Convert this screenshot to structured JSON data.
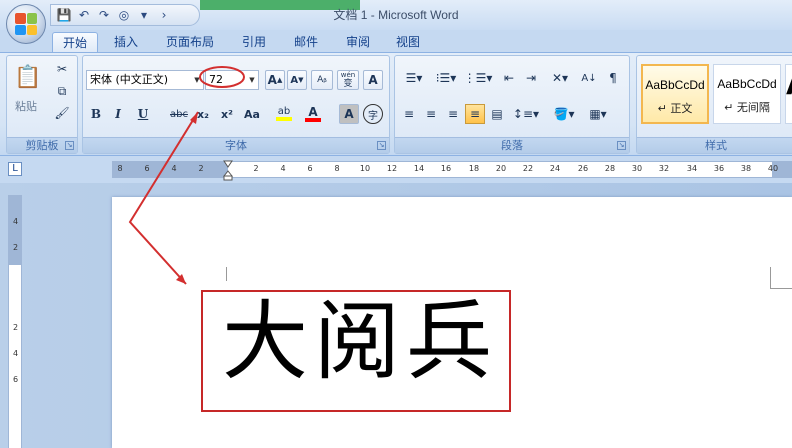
{
  "window": {
    "title": "文档 1 - Microsoft Word"
  },
  "tabs": [
    "开始",
    "插入",
    "页面布局",
    "引用",
    "邮件",
    "审阅",
    "视图"
  ],
  "clipboard": {
    "paste_label": "粘贴",
    "group_label": "剪贴板"
  },
  "font": {
    "name": "宋体 (中文正文)",
    "size": "72",
    "grow_label": "A",
    "shrink_label": "A",
    "wen_label": "wén",
    "bian_label": "变",
    "bold": "B",
    "italic": "I",
    "underline": "U",
    "strike": "abc",
    "subscript": "x₂",
    "superscript": "x²",
    "case": "Aa",
    "highlight": "ab",
    "font_color": "A",
    "shade": "A",
    "enclose": "字",
    "group_label": "字体"
  },
  "paragraph": {
    "group_label": "段落"
  },
  "styles": {
    "items": [
      {
        "sample": "AaBbCcDd",
        "name": "↵ 正文"
      },
      {
        "sample": "AaBbCcDd",
        "name": "↵ 无间隔"
      }
    ],
    "group_label": "样式"
  },
  "ruler": {
    "corner": "L",
    "numbers": [
      "8",
      "6",
      "4",
      "2",
      "2",
      "4",
      "6",
      "8",
      "10",
      "12",
      "14",
      "16",
      "18",
      "20",
      "22",
      "24",
      "26",
      "28",
      "30",
      "32",
      "34",
      "36",
      "38",
      "40"
    ],
    "vnumbers": [
      "4",
      "2",
      "2",
      "4",
      "6"
    ]
  },
  "document": {
    "text": "大阅兵"
  },
  "colors": {
    "annotation_red": "#d32f2f",
    "highlight_yellow": "#ffff00",
    "font_red": "#ff0000",
    "accent_blue": "#15428b"
  },
  "icons": [
    "office-logo-icon",
    "save-icon",
    "undo-icon",
    "redo-icon",
    "clear-icon",
    "customize-icon",
    "cut-icon",
    "copy-icon",
    "format-painter-icon",
    "bullets-icon",
    "numbering-icon",
    "multilevel-icon",
    "decrease-indent-icon",
    "increase-indent-icon",
    "sort-icon",
    "show-marks-icon",
    "align-left-icon",
    "align-center-icon",
    "align-right-icon",
    "justify-icon",
    "distribute-icon",
    "line-spacing-icon",
    "shading-icon",
    "borders-icon"
  ]
}
